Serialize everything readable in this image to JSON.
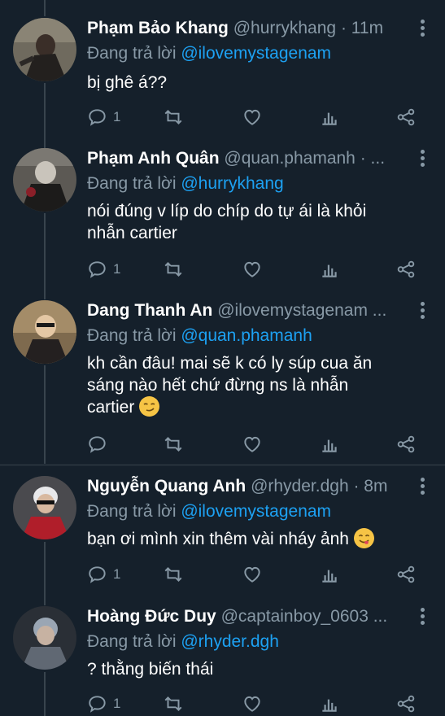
{
  "tweets": [
    {
      "name": "Phạm Bảo Khang",
      "handle": "@hurrykhang",
      "time": "· 11m",
      "reply_prefix": "Đang trả lời",
      "reply_to": "@ilovemystagenam",
      "body_lines": [
        "bị ghê á??"
      ],
      "reply_count": "1"
    },
    {
      "name": "Phạm Anh Quân",
      "handle": "@quan.phamanh · ...",
      "time": "",
      "reply_prefix": "Đang trả lời",
      "reply_to": "@hurrykhang",
      "body_lines": [
        "nói đúng v líp do chíp do tự ái là khỏi",
        "nhẫn cartier"
      ],
      "reply_count": "1"
    },
    {
      "name": "Dang Thanh An",
      "handle": "@ilovemystagenam ...",
      "time": "",
      "reply_prefix": "Đang trả lời",
      "reply_to": "@quan.phamanh",
      "body_lines": [
        "kh cần đâu! mai sẽ k có ly súp cua ăn",
        "sáng nào hết chứ đừng ns là nhẫn",
        "cartier"
      ],
      "body_emoji": "smirk",
      "reply_count": ""
    },
    {
      "name": "Nguyễn Quang Anh",
      "handle": "@rhyder.dgh",
      "time": "· 8m",
      "reply_prefix": "Đang trả lời",
      "reply_to": "@ilovemystagenam",
      "body_lines": [
        "bạn ơi mình xin thêm vài nháy ảnh"
      ],
      "body_emoji": "yum",
      "reply_count": "1"
    },
    {
      "name": "Hoàng Đức Duy",
      "handle": "@captainboy_0603 ...",
      "time": "",
      "reply_prefix": "Đang trả lời",
      "reply_to": "@rhyder.dgh",
      "body_lines": [
        "? thằng biến thái"
      ],
      "reply_count": "1"
    }
  ],
  "icons": {
    "reply": "reply-icon",
    "retweet": "retweet-icon",
    "like": "like-icon",
    "analytics": "analytics-icon",
    "share": "share-icon",
    "more": "more-vertical-icon"
  },
  "colors": {
    "background": "#15202b",
    "secondary_text": "#8899a6",
    "mention": "#1da1f2",
    "divider": "#38444d"
  }
}
